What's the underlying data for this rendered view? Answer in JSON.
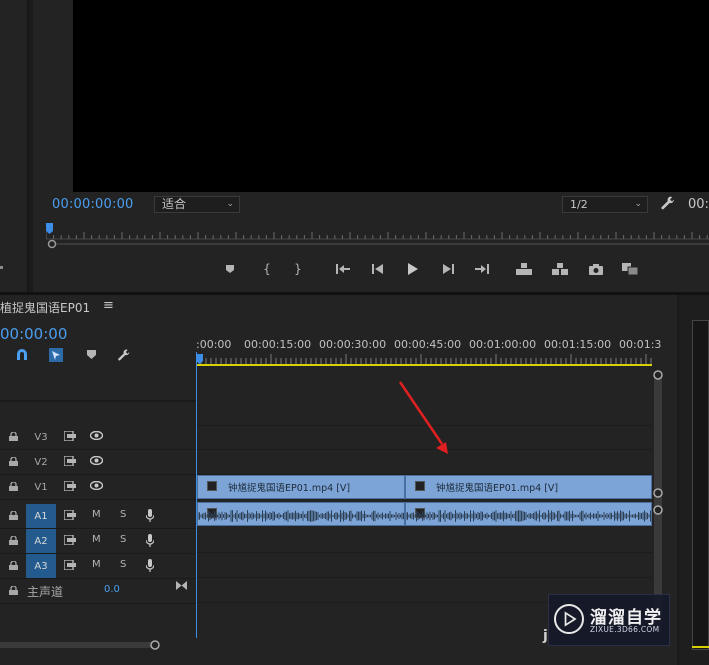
{
  "program_monitor": {
    "timecode": "00:00:00:00",
    "fit_select": "适合",
    "resolution_select": "1/2",
    "right_timecode": "00:"
  },
  "transport_icons": [
    "marker-icon",
    "mark-in-icon",
    "mark-out-icon",
    "go-to-in-icon",
    "step-back-icon",
    "play-icon",
    "step-forward-icon",
    "go-to-out-icon",
    "lift-icon",
    "extract-icon",
    "camera-icon",
    "compare-icon"
  ],
  "timeline": {
    "sequence_tab": "植捉鬼国语EP01",
    "menu_glyph": "≡",
    "timecode": "00:00:00",
    "ruler_labels": [
      ":00:00",
      "00:00:15:00",
      "00:00:30:00",
      "00:00:45:00",
      "00:01:00:00",
      "00:01:15:00",
      "00:01:3"
    ],
    "tracks": [
      {
        "name": "V3",
        "type": "video",
        "active": false
      },
      {
        "name": "V2",
        "type": "video",
        "active": false
      },
      {
        "name": "V1",
        "type": "video",
        "active": true
      },
      {
        "name": "A1",
        "type": "audio",
        "active": true
      },
      {
        "name": "A2",
        "type": "audio",
        "active": true
      },
      {
        "name": "A3",
        "type": "audio",
        "active": true
      }
    ],
    "mute_label": "M",
    "solo_label": "S",
    "master": {
      "label": "主声道",
      "value": "0.0"
    },
    "clips": [
      {
        "label": "钟馗捉鬼国语EP01.mp4 [V]"
      },
      {
        "label": "钟馗捉鬼国语EP01.mp4 [V]"
      }
    ]
  },
  "watermark": {
    "title": "溜溜自学",
    "url": "ZIXUE.3D66.COM",
    "j_letter": "j"
  },
  "colors": {
    "accent_blue": "#4b9ef0",
    "clip_blue": "#7da4d6",
    "track_active": "#235b8f",
    "work_area_yellow": "#d8d000",
    "annotation_red": "#e02020"
  }
}
